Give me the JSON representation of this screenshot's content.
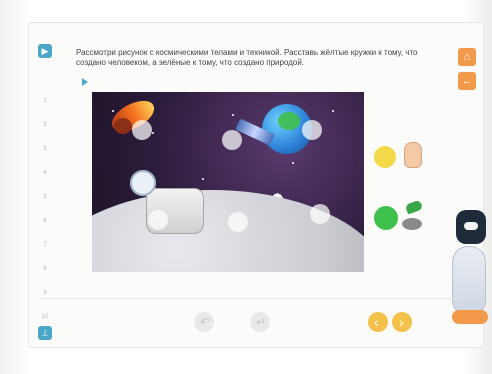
{
  "instruction": {
    "text": "Рассмотри рисунок с космическими телами и техникой. Расставь жёлтые кружки к тому, что создано человеком, а зелёные к тому, что создано природой."
  },
  "ruler": [
    "1",
    "2",
    "3",
    "4",
    "5",
    "6",
    "7",
    "8",
    "9",
    "10"
  ],
  "buttons": {
    "nav_home_icon": "home-icon",
    "nav_back_icon": "back-arrow-icon",
    "side_top_icon": "play-icon",
    "side_bottom_icon": "pointer-icon"
  },
  "colors": {
    "yellow": "#f3d94a",
    "green": "#3fc04c",
    "accent_blue": "#4aa7c9",
    "accent_orange": "#f2994a"
  }
}
